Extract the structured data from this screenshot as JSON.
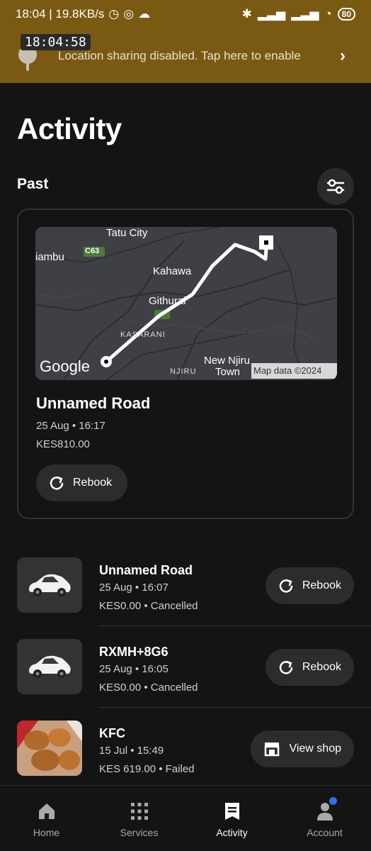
{
  "status_bar": {
    "left_text": "18:04 | 19.8KB/s",
    "battery": "80"
  },
  "overlay_time": "18:04:58",
  "banner": {
    "text": "Location sharing disabled. Tap here to enable",
    "chevron": "›"
  },
  "page": {
    "title": "Activity",
    "section": "Past"
  },
  "featured": {
    "map_labels": {
      "tatu_city": "Tatu City",
      "c63": "C63",
      "kiambu": "iambu",
      "kahawa": "Kahawa",
      "githurai": "Githurai",
      "kasarani": "KASARANI",
      "new_njiru": "New Njiru",
      "town": "Town",
      "njiru": "NJIRU",
      "google": "Google",
      "attribution": "Map data ©2024"
    },
    "title": "Unnamed Road",
    "datetime": "25 Aug • 16:17",
    "price": "KES810.00",
    "rebook_label": "Rebook"
  },
  "trips": [
    {
      "title": "Unnamed Road",
      "datetime": "25 Aug • 16:07",
      "status": "KES0.00 • Cancelled",
      "action": "Rebook",
      "thumb": "car"
    },
    {
      "title": "RXMH+8G6",
      "datetime": "25 Aug • 16:05",
      "status": "KES0.00 • Cancelled",
      "action": "Rebook",
      "thumb": "car"
    },
    {
      "title": "KFC",
      "datetime": "15 Jul • 15:49",
      "status": "KES 619.00 • Failed",
      "action": "View shop",
      "thumb": "food"
    }
  ],
  "nav": [
    {
      "label": "Home",
      "icon": "home-icon"
    },
    {
      "label": "Services",
      "icon": "grid-icon"
    },
    {
      "label": "Activity",
      "icon": "receipt-icon",
      "active": true
    },
    {
      "label": "Account",
      "icon": "person-icon"
    }
  ],
  "colors": {
    "banner": "#7a5a12",
    "background": "#141414",
    "accent_dot": "#2d6ff0"
  }
}
